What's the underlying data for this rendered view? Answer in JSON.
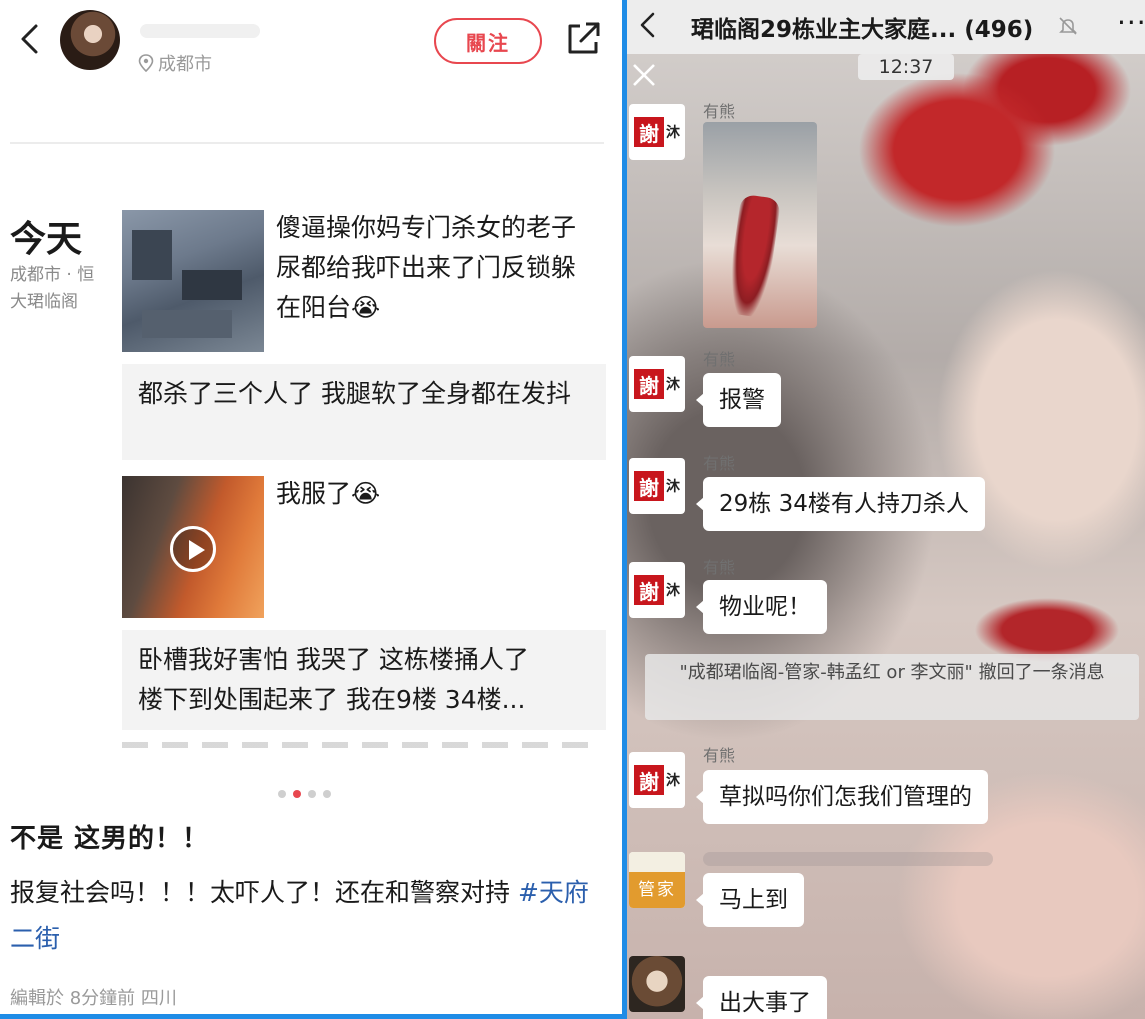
{
  "left_panel": {
    "header": {
      "location": "成都市",
      "follow_label": "關注"
    },
    "feed": {
      "day_label": "今天",
      "day_location": "成都市 · 恒大珺临阁",
      "post1_text": "傻逼操你妈专门杀女的老子尿都给我吓出来了门反锁躲在阳台😭",
      "caption1": "都杀了三个人了 我腿软了全身都在发抖",
      "post2_text": "我服了😭",
      "caption2_line1": "卧槽我好害怕 我哭了 这栋楼捅人了",
      "caption2_line2": "楼下到处围起来了 我在9楼 34楼..."
    },
    "pager": {
      "count": 4,
      "active_index": 1
    },
    "note": {
      "title": "不是 这男的！！",
      "body": "报复社会吗！！！太吓人了！还在和警察对持 ",
      "hashtag": "#天府二街",
      "meta": "編輯於 8分鐘前 四川"
    },
    "colors": {
      "accent": "#e8474f",
      "tag": "#2b5fad"
    }
  },
  "right_panel": {
    "topbar": {
      "title": "珺临阁29栋业主大家庭... (496)",
      "more": "···"
    },
    "time": "12:37",
    "seal_char": "謝",
    "seal_side_char": "沐",
    "messages": [
      {
        "sender": "有熊",
        "type": "image"
      },
      {
        "sender": "有熊",
        "text": "报警"
      },
      {
        "sender": "有熊",
        "text": "29栋 34楼有人持刀杀人"
      },
      {
        "sender": "有熊",
        "text": "物业呢！"
      },
      {
        "sender": "有熊",
        "text": "草拟吗你们怎我们管理的"
      },
      {
        "sender": "",
        "text": "马上到",
        "avatar_label": "管家"
      },
      {
        "sender": "",
        "text": "出大事了"
      }
    ],
    "system_message": "\"成都珺临阁-管家-韩孟红 or 李文丽\" 撤回了一条消息",
    "colors": {
      "topbar": "#ededed",
      "bubble": "#ffffff",
      "divider": "#1f8ce6"
    }
  }
}
